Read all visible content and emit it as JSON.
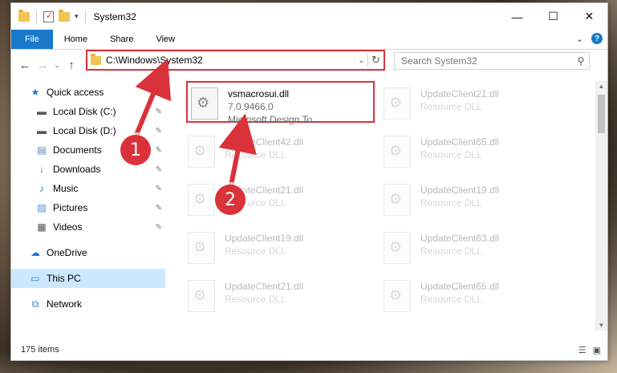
{
  "window": {
    "title": "System32",
    "controls": {
      "minimize": "—",
      "maximize": "☐",
      "close": "✕"
    }
  },
  "ribbon": {
    "tabs": [
      "File",
      "Home",
      "Share",
      "View"
    ],
    "expand": "⌄",
    "help": "?"
  },
  "nav": {
    "back": "←",
    "forward": "→",
    "recent": "⌄",
    "up": "↑"
  },
  "address": {
    "path": "C:\\Windows\\System32",
    "dropdown": "⌄",
    "refresh": "↻"
  },
  "search": {
    "placeholder": "Search System32",
    "icon": "⚲"
  },
  "sidebar": {
    "items": [
      {
        "label": "Quick access",
        "icon": "★",
        "pinned": false
      },
      {
        "label": "Local Disk (C:)",
        "icon": "▬",
        "pinned": true
      },
      {
        "label": "Local Disk (D:)",
        "icon": "▬",
        "pinned": true
      },
      {
        "label": "Documents",
        "icon": "▤",
        "pinned": true
      },
      {
        "label": "Downloads",
        "icon": "↓",
        "pinned": true
      },
      {
        "label": "Music",
        "icon": "♪",
        "pinned": true
      },
      {
        "label": "Pictures",
        "icon": "▨",
        "pinned": true
      },
      {
        "label": "Videos",
        "icon": "▦",
        "pinned": true
      },
      {
        "label": "OneDrive",
        "icon": "☁",
        "pinned": false
      },
      {
        "label": "This PC",
        "icon": "▭",
        "pinned": false
      },
      {
        "label": "Network",
        "icon": "⧉",
        "pinned": false
      }
    ],
    "pin_glyph": "📌"
  },
  "files": [
    {
      "name": "vsmacrosui.dll",
      "line2": "7.0.9466.0",
      "line3": "Microsoft Design To..."
    },
    {
      "name": "UpdateClient21.dll",
      "line2": "Resource DLL"
    },
    {
      "name": "UpdateClient42.dll",
      "line2": "Resource DLL"
    },
    {
      "name": "UpdateClient65.dll",
      "line2": "Resource DLL"
    },
    {
      "name": "UpdateClient21.dll",
      "line2": "Resource DLL"
    },
    {
      "name": "UpdateClient19.dll",
      "line2": "Resource DLL"
    },
    {
      "name": "UpdateClient19.dll",
      "line2": "Resource DLL"
    },
    {
      "name": "UpdateClient63.dll",
      "line2": "Resource DLL"
    },
    {
      "name": "UpdateClient21.dll",
      "line2": "Resource DLL"
    },
    {
      "name": "UpdateClient65.dll",
      "line2": "Resource DLL"
    }
  ],
  "status": {
    "item_count": "175 items"
  },
  "annotations": {
    "badge1": "1",
    "badge2": "2",
    "color": "#d9323a"
  }
}
